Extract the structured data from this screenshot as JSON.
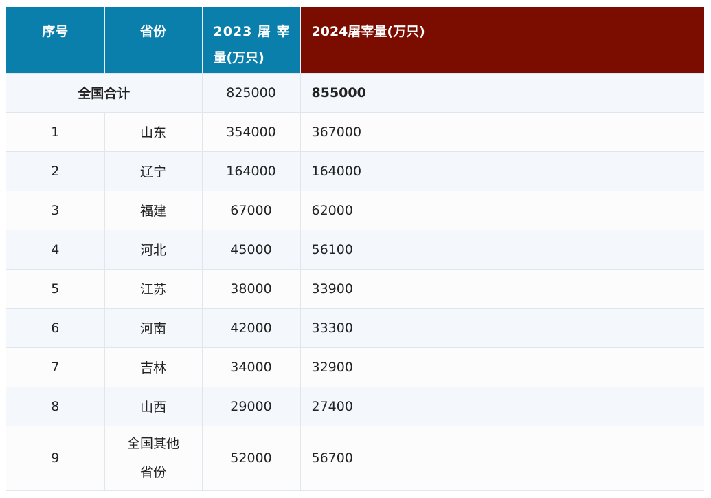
{
  "table": {
    "headers": {
      "index": "序号",
      "province": "省份",
      "y2023_line1": "2023 屠 宰",
      "y2023_line2": "量(万只)",
      "y2024": "2024屠宰量(万只)"
    },
    "total": {
      "label": "全国合计",
      "y2023": "825000",
      "y2024": "855000"
    },
    "rows": [
      {
        "index": "1",
        "province": "山东",
        "y2023": "354000",
        "y2024": "367000"
      },
      {
        "index": "2",
        "province": "辽宁",
        "y2023": "164000",
        "y2024": "164000"
      },
      {
        "index": "3",
        "province": "福建",
        "y2023": "67000",
        "y2024": "62000"
      },
      {
        "index": "4",
        "province": "河北",
        "y2023": "45000",
        "y2024": "56100"
      },
      {
        "index": "5",
        "province": "江苏",
        "y2023": "38000",
        "y2024": "33900"
      },
      {
        "index": "6",
        "province": "河南",
        "y2023": "42000",
        "y2024": "33300"
      },
      {
        "index": "7",
        "province": "吉林",
        "y2023": "34000",
        "y2024": "32900"
      },
      {
        "index": "8",
        "province": "山西",
        "y2023": "29000",
        "y2024": "27400"
      },
      {
        "index": "9",
        "province_line1": "全国其他",
        "province_line2": "省份",
        "y2023": "52000",
        "y2024": "56700"
      }
    ]
  },
  "colors": {
    "header_blue": "#0a7fab",
    "header_red": "#7b0d00",
    "row_odd": "#f4f8fc",
    "row_even": "#fdfcfc"
  }
}
